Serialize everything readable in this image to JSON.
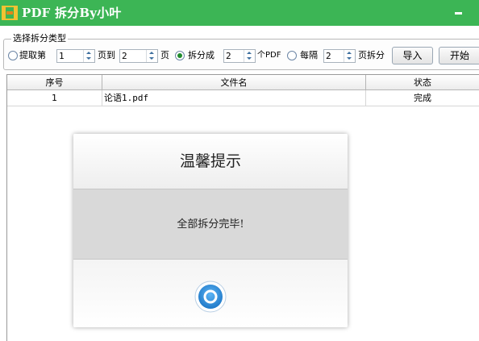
{
  "window": {
    "title": "PDF 拆分By小叶",
    "accent_color": "#3cb555",
    "icon": "split-app-icon"
  },
  "options": {
    "group_label": "选择拆分类型",
    "extract": {
      "prefix": "提取第",
      "from_value": "1",
      "middle": "页到",
      "to_value": "2",
      "suffix": "页",
      "selected": false
    },
    "split_into": {
      "prefix": "拆分成",
      "count_value": "2",
      "suffix": "个PDF",
      "selected": true
    },
    "every": {
      "prefix": "每隔",
      "pages_value": "2",
      "suffix": "页拆分",
      "selected": false
    },
    "import_label": "导入",
    "start_label": "开始"
  },
  "table": {
    "columns": [
      "序号",
      "文件名",
      "状态"
    ],
    "rows": [
      {
        "index": "1",
        "filename": "论语1.pdf",
        "status": "完成"
      }
    ]
  },
  "dialog": {
    "title": "温馨提示",
    "message": "全部拆分完毕!",
    "ok_icon": "ok-circle-icon",
    "ok_color": "#2f8fd8"
  }
}
